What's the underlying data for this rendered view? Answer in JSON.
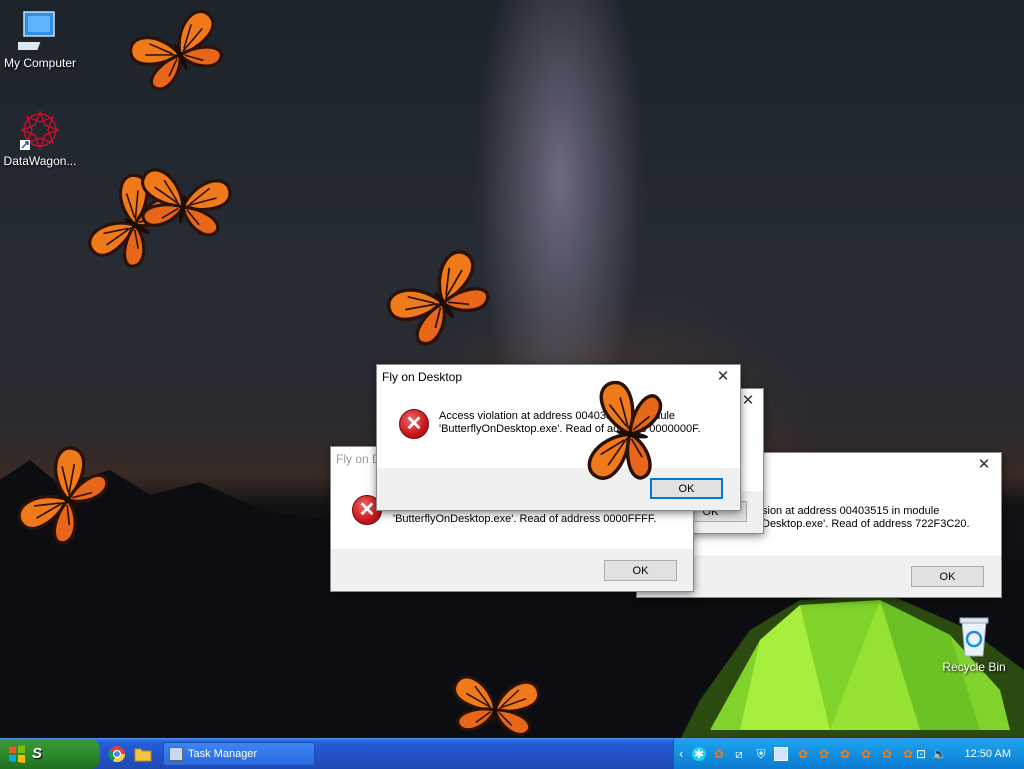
{
  "desktop": {
    "icons": [
      {
        "label": "My Computer"
      },
      {
        "label": "DataWagon..."
      },
      {
        "label": "Recycle Bin"
      }
    ]
  },
  "dialogs": [
    {
      "title": "Fly on Desktop",
      "line1": "Access violation at address 00403515 in module",
      "line2": "'ButterflyOnDesktop.exe'. Read of address 0000000F.",
      "ok": "OK"
    },
    {
      "title": "Fly on D",
      "line2": "'ButterflyOnDesktop.exe'. Read of address 0000FFFF.",
      "ok": "OK"
    },
    {
      "line1": "sion at address 00403515 in module",
      "line2": "Desktop.exe'. Read of address 722F3C20.",
      "ok": "OK"
    },
    {
      "ok": "OK"
    }
  ],
  "taskbar": {
    "start_label": "S",
    "task_item": "Task Manager",
    "clock": "12:50 AM"
  },
  "colors": {
    "taskbar_blue": "#245edb",
    "start_green": "#2c8a2c",
    "tray_blue": "#1290e0",
    "error_red": "#c8151b",
    "butterfly_orange": "#f07a1a"
  }
}
